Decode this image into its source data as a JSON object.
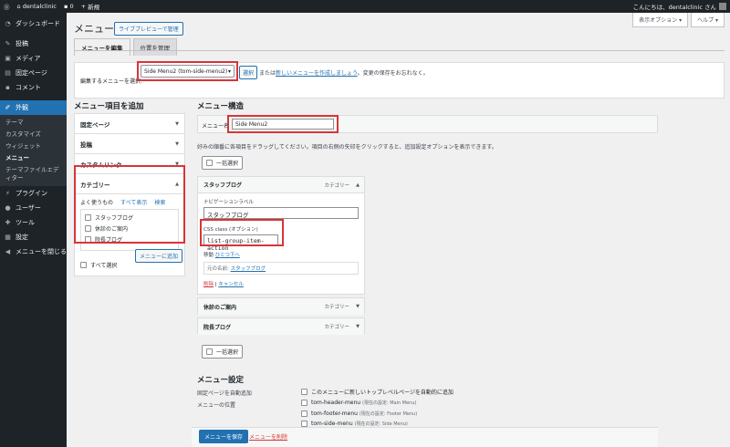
{
  "adminbar": {
    "site_name": "dentalclinic",
    "comment_count": "0",
    "new_label": "新規",
    "greeting": "こんにちは、dentalclinic さん"
  },
  "sidebar": {
    "items": [
      {
        "label": "ダッシュボード",
        "icon": "dashboard-icon"
      },
      {
        "label": "投稿",
        "icon": "pin-icon"
      },
      {
        "label": "メディア",
        "icon": "media-icon"
      },
      {
        "label": "固定ページ",
        "icon": "page-icon"
      },
      {
        "label": "コメント",
        "icon": "comment-icon"
      },
      {
        "label": "外観",
        "icon": "brush-icon"
      }
    ],
    "submenu": [
      "テーマ",
      "カスタマイズ",
      "ウィジェット",
      "メニュー",
      "テーマファイルエディター"
    ],
    "items2": [
      {
        "label": "プラグイン",
        "icon": "plugin-icon"
      },
      {
        "label": "ユーザー",
        "icon": "user-icon"
      },
      {
        "label": "ツール",
        "icon": "tool-icon"
      },
      {
        "label": "設定",
        "icon": "settings-icon"
      },
      {
        "label": "メニューを閉じる",
        "icon": "collapse-icon"
      }
    ]
  },
  "header": {
    "screen_options": "表示オプション ▾",
    "help": "ヘルプ ▾",
    "title": "メニュー",
    "preview_button": "ライブプレビューで管理",
    "tab_edit": "メニューを編集",
    "tab_locations": "位置を管理"
  },
  "select_bar": {
    "label": "編集するメニューを選択:",
    "selected": "Side Menu2 (tom-side-menu2)",
    "select_button": "選択",
    "text_before": "または",
    "link": "新しいメニューを作成しましょう",
    "text_after": "。変更の保存をお忘れなく。"
  },
  "add_items": {
    "heading": "メニュー項目を追加",
    "sections": [
      "固定ページ",
      "投稿",
      "カスタムリンク",
      "カテゴリー"
    ],
    "subtabs": [
      "よく使うもの",
      "すべて表示",
      "検索"
    ],
    "categories": [
      "スタッフブログ",
      "休診のご案内",
      "院長ブログ"
    ],
    "select_all": "すべて選択",
    "add_button": "メニューに追加"
  },
  "structure": {
    "heading": "メニュー構造",
    "name_label": "メニュー名",
    "menu_name": "Side Menu2",
    "instructions": "好みの順番に各項目をドラッグしてください。項目の右側の矢印をクリックすると、追加設定オプションを表示できます。",
    "bulk_select": "一括選択",
    "items": [
      {
        "title": "スタッフブログ",
        "type": "カテゴリー"
      },
      {
        "title": "休診のご案内",
        "type": "カテゴリー"
      },
      {
        "title": "院長ブログ",
        "type": "カテゴリー"
      }
    ],
    "nav_label_caption": "ナビゲーションラベル",
    "nav_label_value": "スタッフブログ",
    "css_caption": "CSS class (オプション)",
    "css_value": "list-group-item-action",
    "move_label": "移動",
    "move_link": "ひとつ下へ",
    "original_label": "元の名前:",
    "original_link": "スタッフブログ",
    "remove": "削除",
    "cancel": "キャンセル"
  },
  "settings": {
    "heading": "メニュー設定",
    "auto_add_label": "固定ページを自動追加",
    "auto_add_option": "このメニューに新しいトップレベルページを自動的に追加",
    "location_label": "メニューの位置",
    "locations": [
      {
        "name": "tom-header-menu",
        "note": "(現在の設定: Main Menu)"
      },
      {
        "name": "tom-footer-menu",
        "note": "(現在の設定: Footer Menu)"
      },
      {
        "name": "tom-side-menu",
        "note": "(現在の設定: Side Menu)"
      }
    ],
    "save_button": "メニューを保存",
    "delete_link": "メニューを削除"
  }
}
